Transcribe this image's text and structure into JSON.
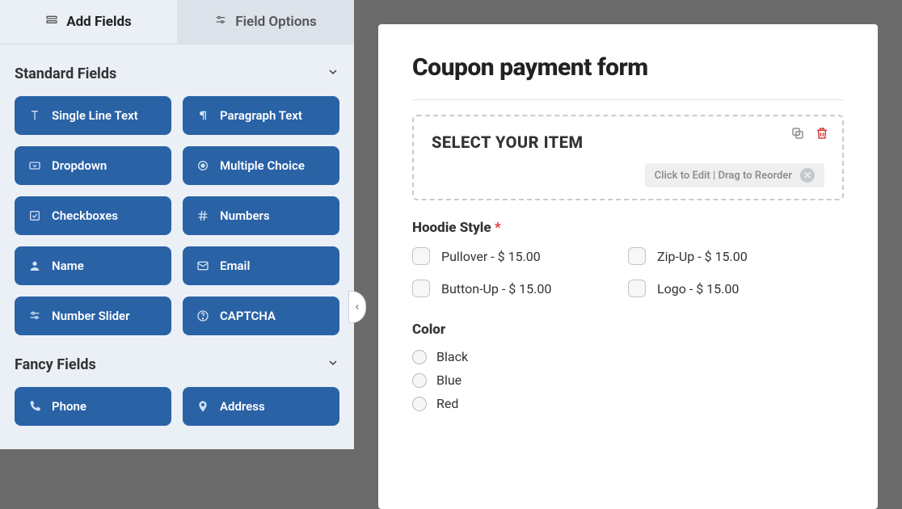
{
  "tabs": {
    "add_fields": "Add Fields",
    "field_options": "Field Options"
  },
  "sections": {
    "standard": {
      "title": "Standard Fields"
    },
    "fancy": {
      "title": "Fancy Fields"
    }
  },
  "standard_fields": {
    "single_line_text": "Single Line Text",
    "paragraph_text": "Paragraph Text",
    "dropdown": "Dropdown",
    "multiple_choice": "Multiple Choice",
    "checkboxes": "Checkboxes",
    "numbers": "Numbers",
    "name": "Name",
    "email": "Email",
    "number_slider": "Number Slider",
    "captcha": "CAPTCHA"
  },
  "fancy_fields": {
    "phone": "Phone",
    "address": "Address"
  },
  "form": {
    "title": "Coupon payment form",
    "section_title": "SELECT YOUR ITEM",
    "hint": "Click to Edit | Drag to Reorder"
  },
  "hoodie": {
    "label": "Hoodie Style",
    "options": {
      "pullover": "Pullover - $ 15.00",
      "zipup": "Zip-Up - $ 15.00",
      "buttonup": "Button-Up - $ 15.00",
      "logo": "Logo - $ 15.00"
    }
  },
  "color": {
    "label": "Color",
    "options": {
      "black": "Black",
      "blue": "Blue",
      "red": "Red"
    }
  }
}
